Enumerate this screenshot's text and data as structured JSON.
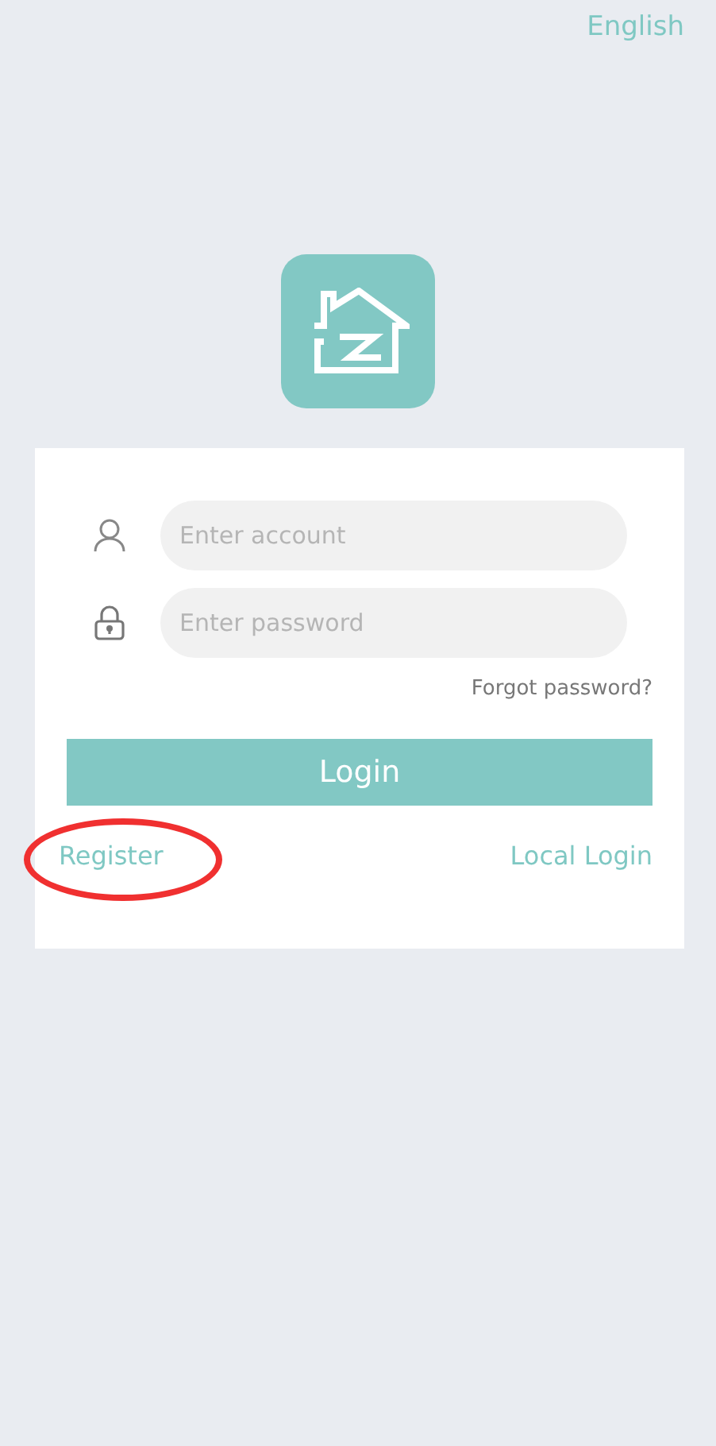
{
  "language": "English",
  "fields": [
    {
      "kind": "account",
      "placeholder": "Enter account"
    },
    {
      "kind": "password",
      "placeholder": "Enter password"
    }
  ],
  "forgot_link": "Forgot password?",
  "login_button": "Login",
  "register_link": {
    "label": "Register",
    "circled": true
  },
  "local_login_link": "Local Login"
}
